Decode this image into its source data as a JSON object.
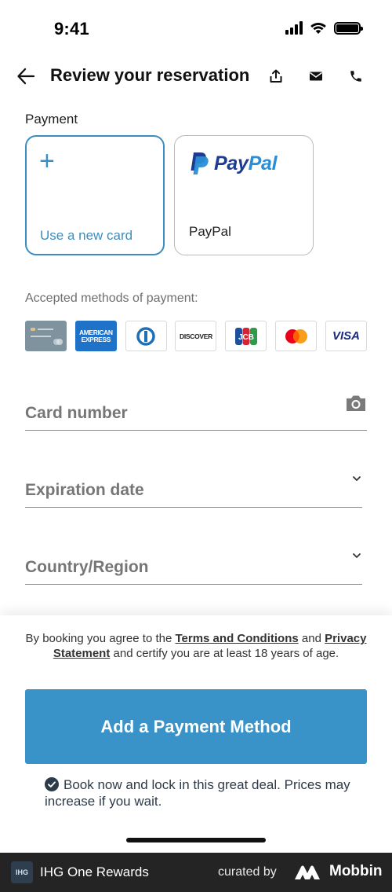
{
  "status_bar": {
    "time": "9:41"
  },
  "header": {
    "title": "Review your reservation"
  },
  "payment": {
    "section_label": "Payment",
    "new_card_label": "Use a new card",
    "paypal_logo_text_1": "Pay",
    "paypal_logo_text_2": "Pal",
    "paypal_label": "PayPal"
  },
  "accepted": {
    "label": "Accepted methods of payment:",
    "logos": [
      {
        "icon": "bank-card-icon"
      },
      {
        "icon": "american-express-icon",
        "line1": "AMERICAN",
        "line2": "EXPRESS"
      },
      {
        "icon": "diners-club-icon"
      },
      {
        "icon": "discover-icon",
        "text": "DISCOVER"
      },
      {
        "icon": "jcb-icon"
      },
      {
        "icon": "mastercard-icon"
      },
      {
        "icon": "visa-icon",
        "text": "VISA"
      }
    ]
  },
  "form": {
    "card_number_placeholder": "Card number",
    "expiration_placeholder": "Expiration date",
    "country_placeholder": "Country/Region"
  },
  "footer": {
    "terms_prefix": "By booking you agree to the",
    "terms_link": "Terms and Conditions",
    "terms_and": "and",
    "privacy_link": "Privacy Statement",
    "terms_suffix": "and certify you are at least 18 years of age.",
    "cta_label": "Add a Payment Method",
    "deal_text": "Book now and lock in this great deal. Prices may increase if you wait."
  },
  "banner": {
    "app_logo_text": "IHG",
    "app_name": "IHG One Rewards",
    "curated_by": "curated by",
    "brand": "Mobbin"
  },
  "colors": {
    "accent": "#3a93c8",
    "paypal_dark": "#1d3b8f",
    "paypal_light": "#2a8ed6",
    "banner_bg": "#242424"
  }
}
